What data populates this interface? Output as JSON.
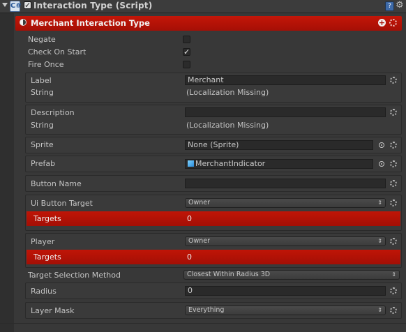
{
  "component": {
    "title": "Interaction Type (Script)",
    "script_icon": "C#",
    "enabled": true,
    "help_icon": "help-icon",
    "gear_icon": "gear-icon"
  },
  "type_bar": {
    "title": "Merchant Interaction Type",
    "color": "#b31307"
  },
  "toggles": [
    {
      "label": "Negate",
      "checked": false
    },
    {
      "label": "Check On Start",
      "checked": true
    },
    {
      "label": "Fire Once",
      "checked": false
    }
  ],
  "label_group": {
    "label": "Label",
    "value": "Merchant",
    "type_label": "String",
    "type_value": "(Localization Missing)"
  },
  "description_group": {
    "label": "Description",
    "value": "",
    "type_label": "String",
    "type_value": "(Localization Missing)"
  },
  "sprite": {
    "label": "Sprite",
    "value": "None (Sprite)"
  },
  "prefab": {
    "label": "Prefab",
    "value": "MerchantIndicator"
  },
  "button_name": {
    "label": "Button Name",
    "value": ""
  },
  "ui_button_target": {
    "label": "Ui Button Target",
    "value": "Owner",
    "targets_label": "Targets",
    "targets_value": "0"
  },
  "player": {
    "label": "Player",
    "value": "Owner",
    "targets_label": "Targets",
    "targets_value": "0"
  },
  "target_selection": {
    "label": "Target Selection Method",
    "value": "Closest Within Radius 3D"
  },
  "radius": {
    "label": "Radius",
    "value": "0"
  },
  "layer_mask": {
    "label": "Layer Mask",
    "value": "Everything"
  },
  "icons": {
    "arrow": "▾",
    "check": "✓",
    "plus": "+",
    "gear": "⚙",
    "updown": "⇕"
  }
}
